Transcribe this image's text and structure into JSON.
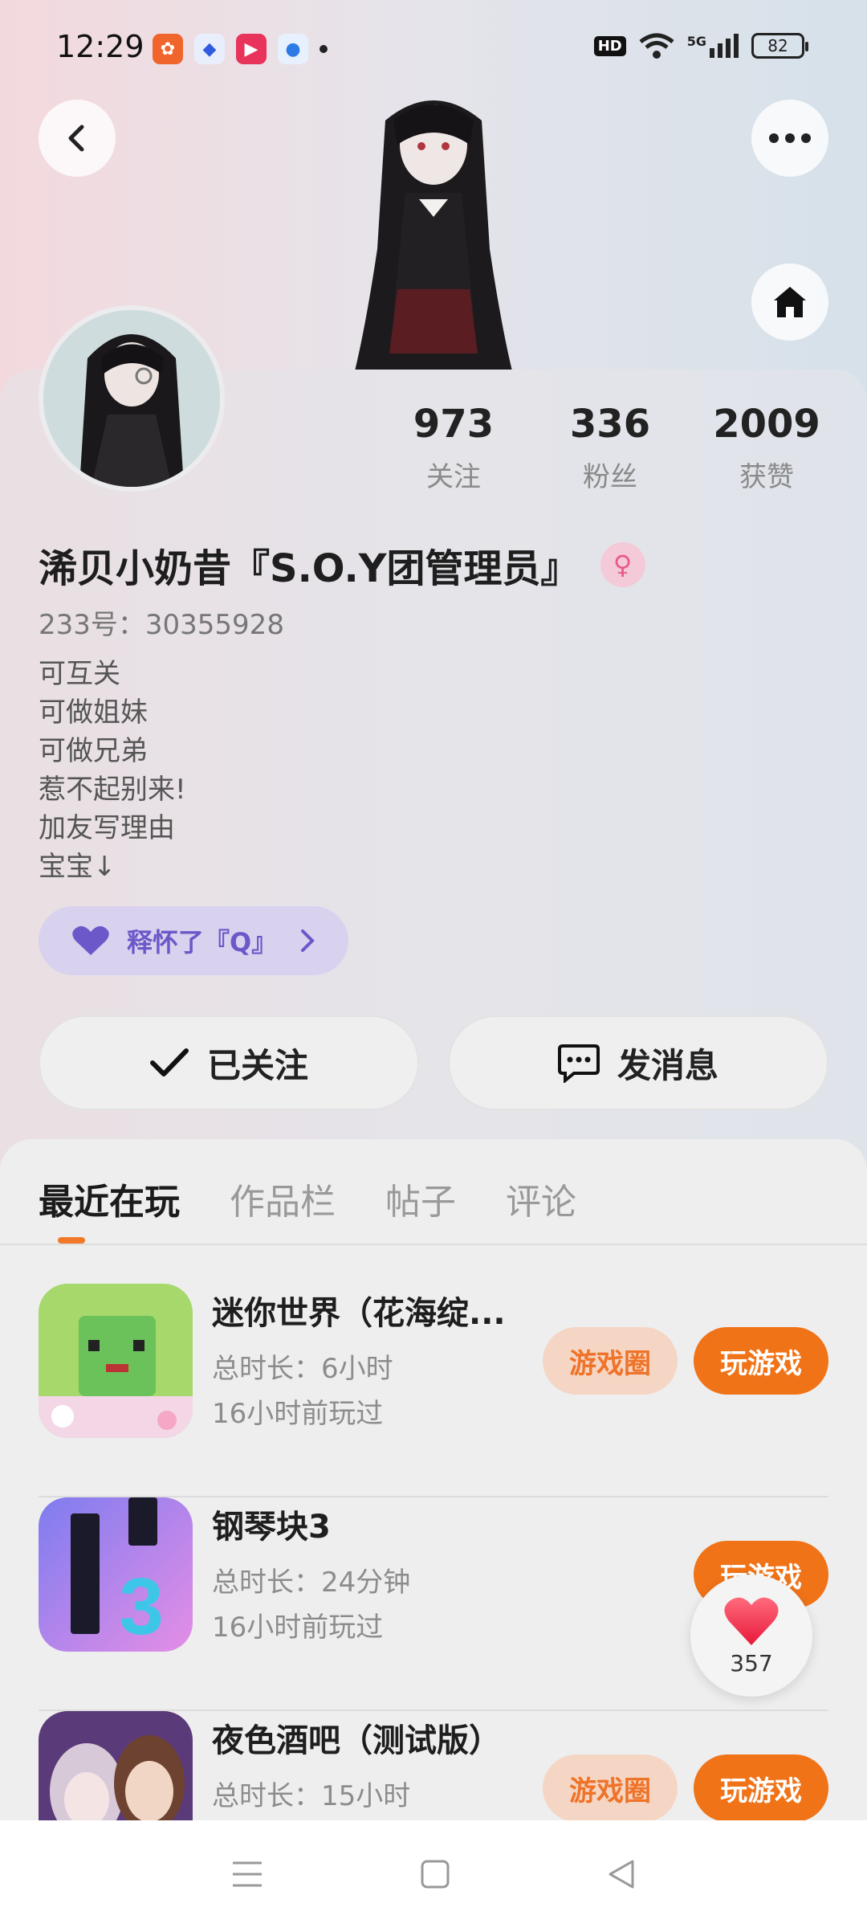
{
  "status_bar": {
    "time": "12:29",
    "network": "5G",
    "battery": "82",
    "hd": "HD"
  },
  "header": {
    "back_icon": "chevron-left-icon",
    "more_icon": "more-dots-icon",
    "home_icon": "home-icon"
  },
  "profile": {
    "nickname": "浠贝小奶昔『S.O.Y团管理员』",
    "gender": "female",
    "user_id": "233号：30355928",
    "bio": [
      "可互关",
      "可做姐妹",
      "可做兄弟",
      "惹不起别来!",
      "加友写理由",
      "宝宝↓"
    ],
    "stats": [
      {
        "value": "973",
        "label": "关注"
      },
      {
        "value": "336",
        "label": "粉丝"
      },
      {
        "value": "2009",
        "label": "获赞"
      }
    ],
    "group_tag": "释怀了『Q』"
  },
  "actions": {
    "follow_label": "已关注",
    "message_label": "发消息"
  },
  "tabs": [
    "最近在玩",
    "作品栏",
    "帖子",
    "评论"
  ],
  "games": [
    {
      "title": "迷你世界（花海绽...",
      "duration": "总时长：6小时",
      "last_played": "16小时前玩过",
      "circle_label": "游戏圈",
      "play_label": "玩游戏"
    },
    {
      "title": "钢琴块3",
      "duration": "总时长：24分钟",
      "last_played": "16小时前玩过",
      "circle_label": "",
      "play_label": "玩游戏"
    },
    {
      "title": "夜色酒吧（测试版）",
      "duration": "总时长：15小时",
      "last_played": "",
      "circle_label": "游戏圈",
      "play_label": "玩游戏"
    }
  ],
  "like_fab": {
    "count": "357"
  },
  "colors": {
    "accent": "#f07318",
    "accent_light": "#f5d6c4",
    "tag_purple": "#6c58c9"
  }
}
